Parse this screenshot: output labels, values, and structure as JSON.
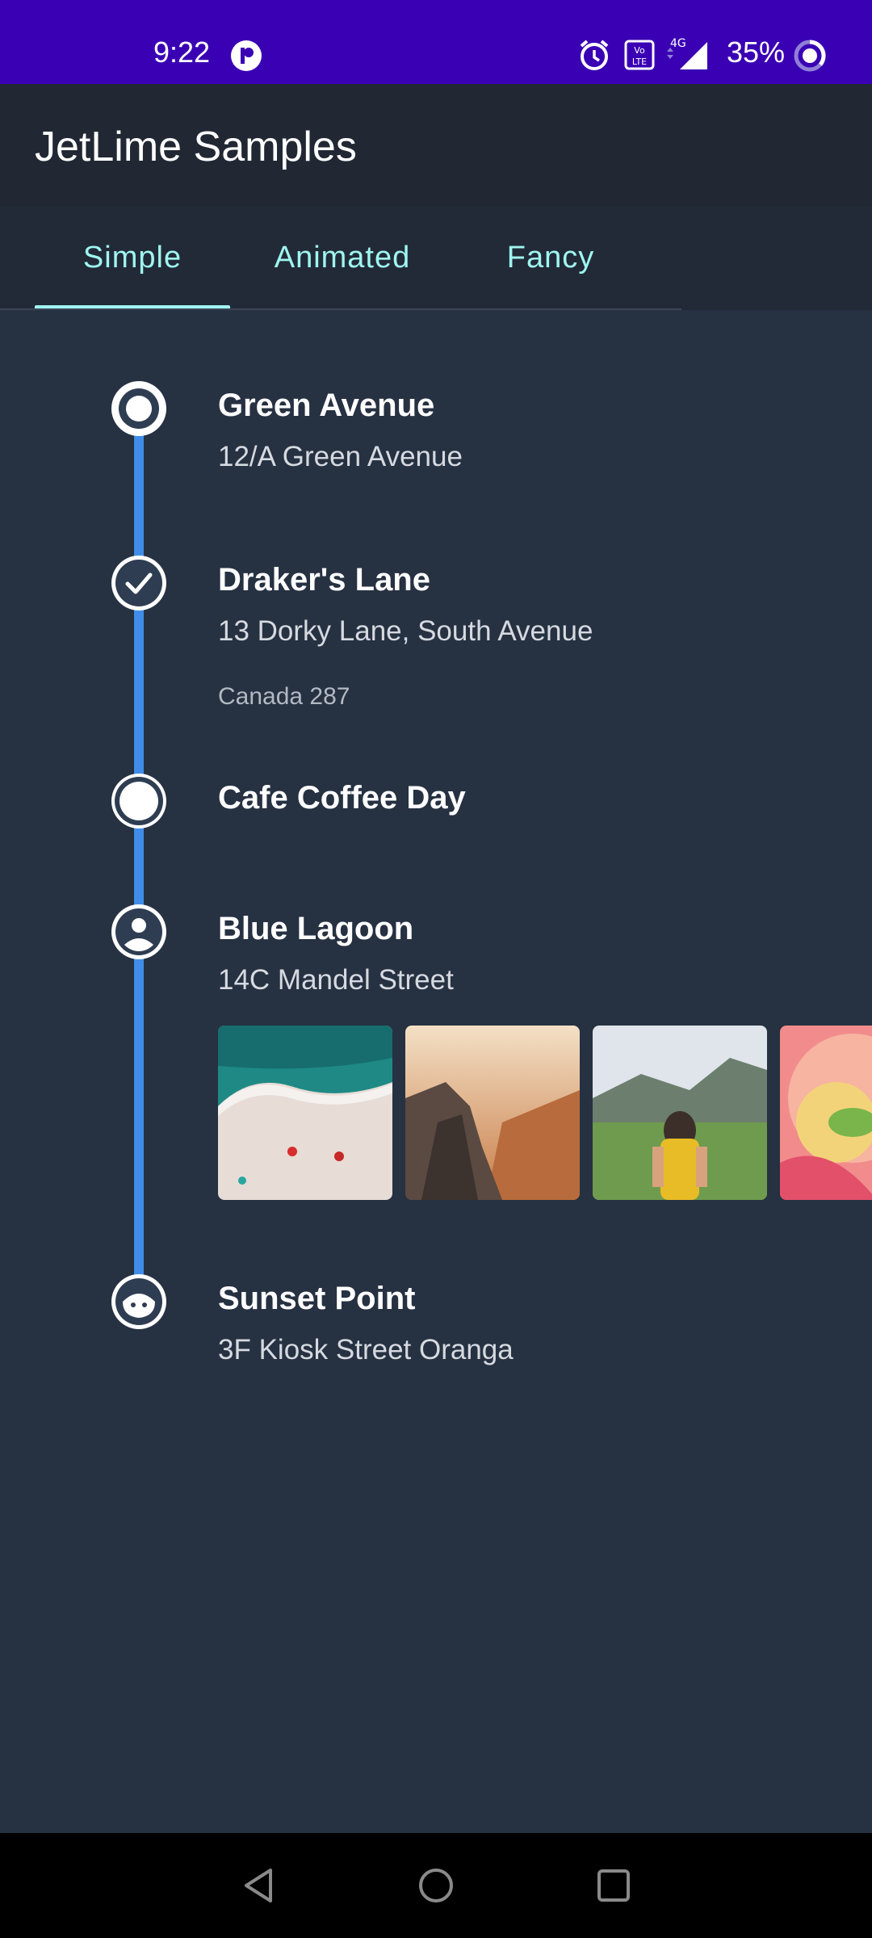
{
  "status_bar": {
    "time": "9:22",
    "battery": "35%",
    "icons": [
      "media-icon",
      "alarm-icon",
      "volte-icon",
      "signal-4g-icon",
      "battery-icon"
    ]
  },
  "app_bar": {
    "title": "JetLime Samples"
  },
  "tabs": [
    {
      "label": "Simple",
      "selected": true
    },
    {
      "label": "Animated",
      "selected": false
    },
    {
      "label": "Fancy",
      "selected": false
    }
  ],
  "timeline": {
    "line_color": "#3f8de8",
    "items": [
      {
        "title": "Green Avenue",
        "subtitle": "12/A Green Avenue",
        "icon": "radio-ring-icon"
      },
      {
        "title": "Draker's Lane",
        "subtitle": "13 Dorky Lane, South Avenue",
        "extra": "Canada 287",
        "icon": "check-icon"
      },
      {
        "title": "Cafe Coffee Day",
        "icon": "filled-dot-icon"
      },
      {
        "title": "Blue Lagoon",
        "subtitle": "14C Mandel Street",
        "icon": "person-icon",
        "photos": [
          "beach-photo",
          "cliff-photo",
          "hiker-photo",
          "flower-photo"
        ]
      },
      {
        "title": "Sunset Point",
        "subtitle": "3F Kiosk Street Oranga",
        "icon": "face-icon"
      }
    ]
  },
  "colors": {
    "status_bar": "#3a00b4",
    "app_bar": "#212833",
    "background": "#263142",
    "tab_accent": "#9ff6f0"
  }
}
